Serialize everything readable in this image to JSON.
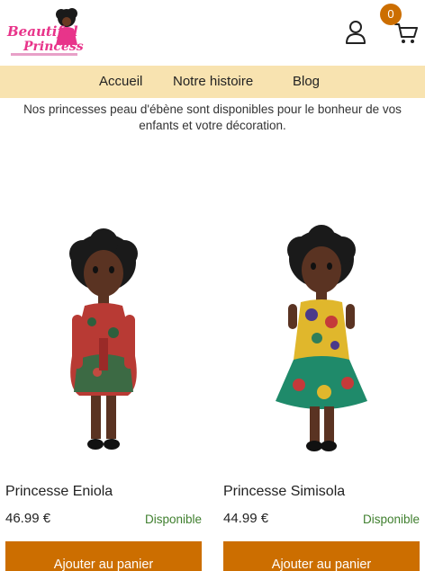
{
  "header": {
    "logo_line1": "Beautiful",
    "logo_line2": "Princess",
    "cart_count": "0"
  },
  "nav": {
    "items": [
      "Accueil",
      "Notre histoire",
      "Blog"
    ]
  },
  "intro": "Nos princesses peau d'ébène sont disponibles pour le bonheur de vos enfants et votre décoration.",
  "products": [
    {
      "name": "Princesse Eniola",
      "price": "46.99 €",
      "stock": "Disponible",
      "button": "Ajouter au panier"
    },
    {
      "name": "Princesse Simisola",
      "price": "44.99 €",
      "stock": "Disponible",
      "button": "Ajouter au panier"
    }
  ],
  "colors": {
    "accent": "#cc6e00",
    "nav_bg": "#f8e3b0",
    "stock_green": "#3f7f2e",
    "logo_pink": "#e8348a"
  },
  "icons": [
    "account-icon",
    "cart-icon"
  ]
}
